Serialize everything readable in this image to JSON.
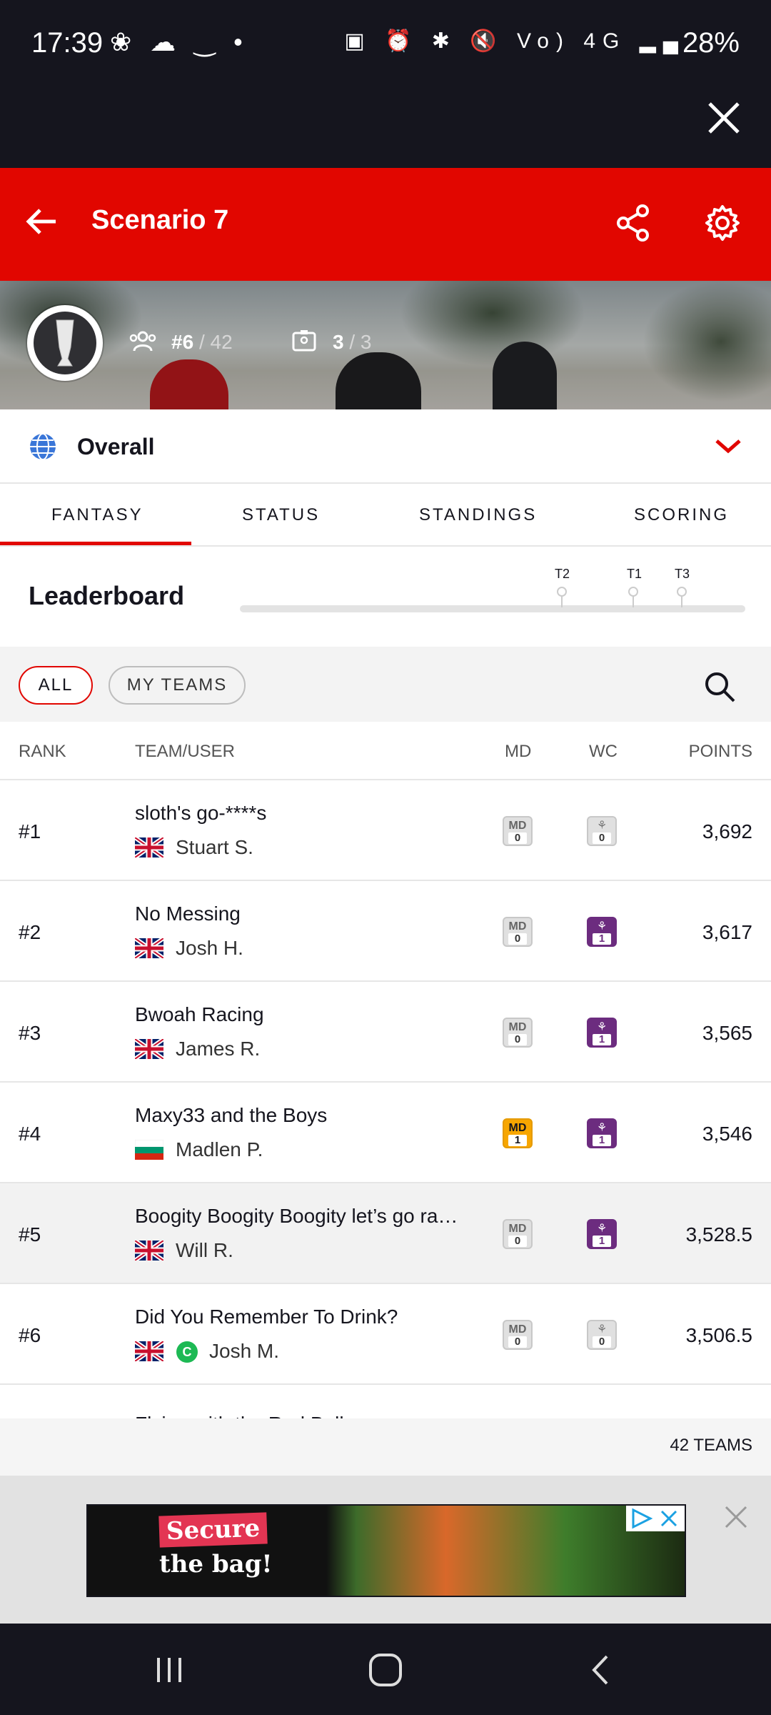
{
  "status_bar": {
    "time": "17:39",
    "left_icons": "❀ ☁ ‿ •",
    "right_icons": "▣ ⏰ ✱ 🔇 Vo) 4G ▂▄",
    "battery": "28%"
  },
  "header": {
    "title": "Scenario 7"
  },
  "hero": {
    "rank": "#6",
    "rank_total": "/ 42",
    "teams": "3",
    "teams_total": "/ 3"
  },
  "league_selector": {
    "label": "Overall"
  },
  "tabs": [
    {
      "label": "FANTASY",
      "active": true
    },
    {
      "label": "STATUS",
      "active": false
    },
    {
      "label": "STANDINGS",
      "active": false
    },
    {
      "label": "SCORING",
      "active": false
    }
  ],
  "leaderboard": {
    "title": "Leaderboard",
    "markers": [
      "T2",
      "T1",
      "T3"
    ]
  },
  "filters": {
    "all": "ALL",
    "my_teams": "MY TEAMS"
  },
  "table": {
    "headers": {
      "rank": "RANK",
      "team": "TEAM/USER",
      "md": "MD",
      "wc": "WC",
      "points": "POINTS"
    },
    "chip_label_md": "MD",
    "rows": [
      {
        "rank": "#1",
        "team": "sloth's go-****s",
        "user": "Stuart S.",
        "md": "0",
        "wc": "0",
        "points": "3,692"
      },
      {
        "rank": "#2",
        "team": "No Messing",
        "user": "Josh H.",
        "md": "0",
        "wc": "1",
        "points": "3,617"
      },
      {
        "rank": "#3",
        "team": "Bwoah Racing",
        "user": "James R.",
        "md": "0",
        "wc": "1",
        "points": "3,565"
      },
      {
        "rank": "#4",
        "team": "Maxy33 and the Boys",
        "user": "Madlen P.",
        "md": "1",
        "wc": "1",
        "points": "3,546"
      },
      {
        "rank": "#5",
        "team": "Boogity Boogity Boogity let’s go rac...",
        "user": "Will R.",
        "md": "0",
        "wc": "1",
        "points": "3,528.5"
      },
      {
        "rank": "#6",
        "team": "Did You Remember To Drink?",
        "user": "Josh M.",
        "md": "0",
        "wc": "0",
        "points": "3,506.5",
        "badge": "C"
      },
      {
        "rank": "",
        "team": "Flying with the Red Bulls",
        "user": "",
        "md": "",
        "wc": "",
        "points": ""
      }
    ],
    "count": "42 TEAMS"
  },
  "ad": {
    "line1": "Secure",
    "line2": "the bag!"
  },
  "colors": {
    "brand_red": "#e10600",
    "dark": "#15151e",
    "wildcard_purple": "#6c2c7f",
    "megadriver_yellow": "#f7a600"
  }
}
